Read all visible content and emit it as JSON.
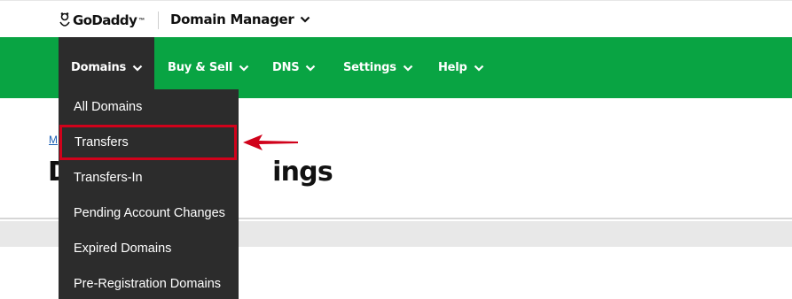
{
  "header": {
    "brand": "GoDaddy",
    "brand_tm": "™",
    "app_title": "Domain Manager"
  },
  "nav": {
    "items": [
      {
        "label": "Domains",
        "active": true
      },
      {
        "label": "Buy & Sell"
      },
      {
        "label": "DNS"
      },
      {
        "label": "Settings"
      },
      {
        "label": "Help"
      }
    ]
  },
  "content": {
    "breadcrumb_visible": "M",
    "title_visible_left": "D",
    "title_visible_right": "ings"
  },
  "dropdown": {
    "items": [
      {
        "label": "All Domains"
      },
      {
        "label": "Transfers",
        "highlighted": true
      },
      {
        "label": "Transfers-In"
      },
      {
        "label": "Pending Account Changes"
      },
      {
        "label": "Expired Domains"
      },
      {
        "label": "Pre-Registration Domains"
      }
    ]
  },
  "colors": {
    "nav_green": "#09a443",
    "dropdown_bg": "#2c2c2c",
    "highlight_red": "#d0021b"
  },
  "icons": {
    "logo": "godaddy-logo-icon",
    "chevron": "chevron-down-icon",
    "arrow": "red-arrow-icon"
  }
}
